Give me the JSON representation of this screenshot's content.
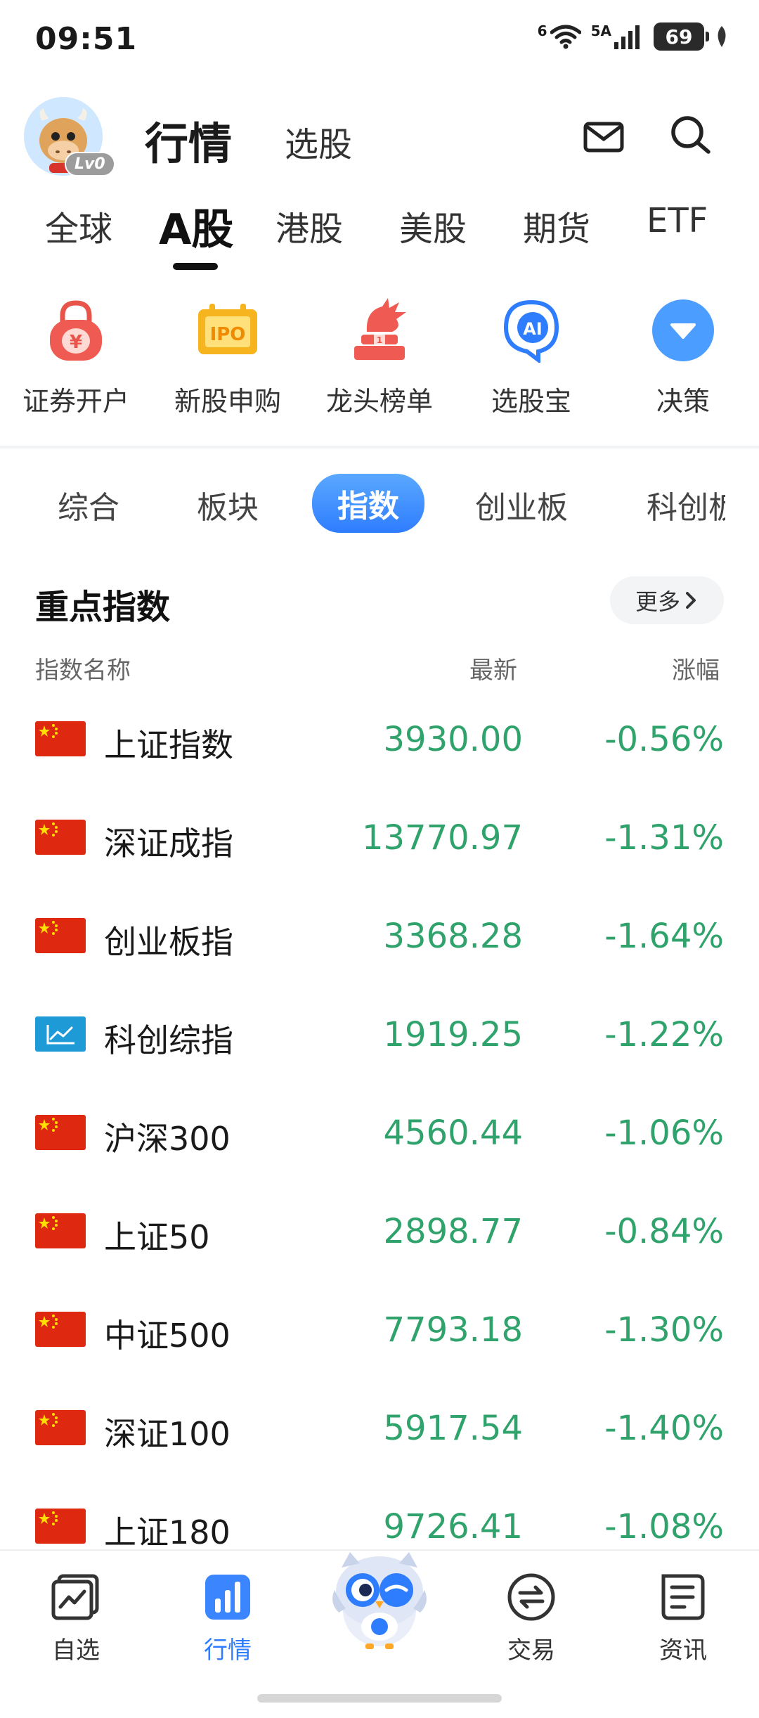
{
  "status_bar": {
    "time": "09:51",
    "wifi_label": "6",
    "signal_label": "5A",
    "battery": "69"
  },
  "header": {
    "level_badge": "Lv0",
    "title": "行情",
    "subtitle": "选股"
  },
  "market_tabs": [
    "全球",
    "A股",
    "港股",
    "美股",
    "期货",
    "ETF"
  ],
  "quick_actions": [
    {
      "label": "证券开户",
      "icon": "lock-yen-icon"
    },
    {
      "label": "新股申购",
      "icon": "ipo-icon",
      "icon_text": "IPO"
    },
    {
      "label": "龙头榜单",
      "icon": "dragon-icon"
    },
    {
      "label": "选股宝",
      "icon": "ai-icon",
      "icon_text": "AI"
    },
    {
      "label": "决策",
      "icon": "dropdown-icon"
    }
  ],
  "sub_tabs": [
    "综合",
    "板块",
    "指数",
    "创业板",
    "科创板"
  ],
  "section": {
    "title": "重点指数",
    "more": "更多",
    "columns": {
      "name": "指数名称",
      "last": "最新",
      "change": "涨幅"
    }
  },
  "indices": [
    {
      "name": "上证指数",
      "last": "3930.00",
      "change": "-0.56%",
      "flag": "cn"
    },
    {
      "name": "深证成指",
      "last": "13770.97",
      "change": "-1.31%",
      "flag": "cn"
    },
    {
      "name": "创业板指",
      "last": "3368.28",
      "change": "-1.64%",
      "flag": "cn"
    },
    {
      "name": "科创综指",
      "last": "1919.25",
      "change": "-1.22%",
      "flag": "chart"
    },
    {
      "name": "沪深300",
      "last": "4560.44",
      "change": "-1.06%",
      "flag": "cn"
    },
    {
      "name": "上证50",
      "last": "2898.77",
      "change": "-0.84%",
      "flag": "cn"
    },
    {
      "name": "中证500",
      "last": "7793.18",
      "change": "-1.30%",
      "flag": "cn"
    },
    {
      "name": "深证100",
      "last": "5917.54",
      "change": "-1.40%",
      "flag": "cn"
    },
    {
      "name": "上证180",
      "last": "9726.41",
      "change": "-1.08%",
      "flag": "cn"
    }
  ],
  "bottom_nav": [
    {
      "label": "自选",
      "icon": "trend-chart-icon"
    },
    {
      "label": "行情",
      "icon": "bar-chart-icon"
    },
    {
      "label": "",
      "icon": "owl-mascot-icon"
    },
    {
      "label": "交易",
      "icon": "exchange-icon"
    },
    {
      "label": "资讯",
      "icon": "news-icon"
    }
  ],
  "colors": {
    "accent": "#2f7dff",
    "down": "#2fa36b",
    "flag_red": "#de2910",
    "flag_yellow": "#ffde00"
  }
}
